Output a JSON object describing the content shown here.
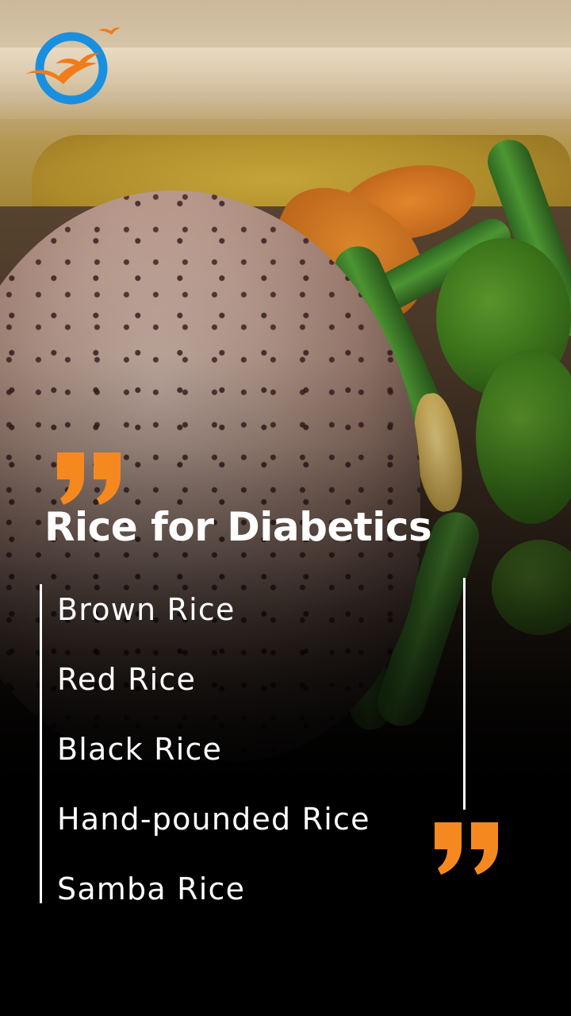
{
  "logo": {
    "name": "ring-with-flying-birds-logo",
    "ring_color": "#1a8fe0",
    "bird_color": "#f07c1a"
  },
  "title": "Rice for Diabetics",
  "rice_list": [
    {
      "label": "Brown Rice"
    },
    {
      "label": "Red Rice"
    },
    {
      "label": "Black Rice"
    },
    {
      "label": "Hand-pounded Rice"
    },
    {
      "label": "Samba Rice"
    }
  ],
  "quotes": {
    "open_icon": "opening-quote-icon",
    "close_icon": "closing-quote-icon",
    "color": "#f5891f"
  },
  "colors": {
    "text": "#ffffff",
    "accent": "#f5891f",
    "background": "#000000"
  }
}
